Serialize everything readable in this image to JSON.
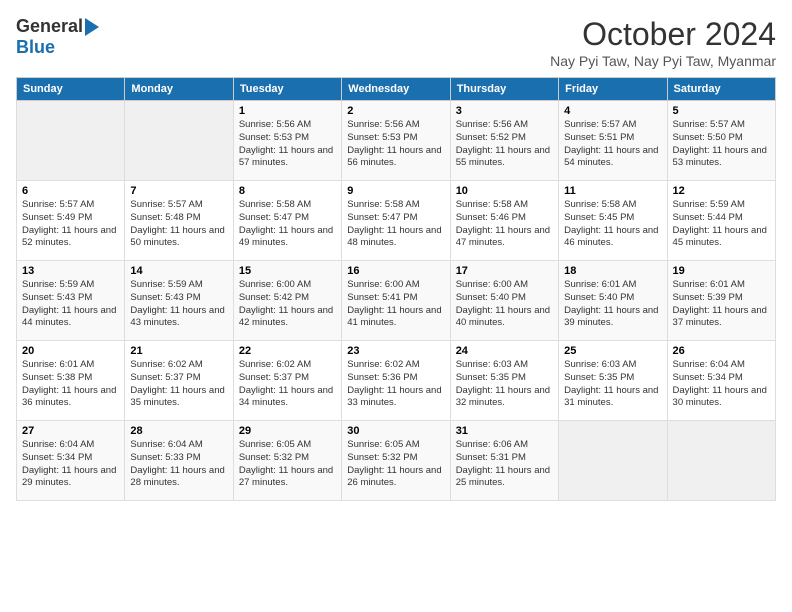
{
  "header": {
    "logo": {
      "general": "General",
      "blue": "Blue"
    },
    "title": "October 2024",
    "location": "Nay Pyi Taw, Nay Pyi Taw, Myanmar"
  },
  "days_of_week": [
    "Sunday",
    "Monday",
    "Tuesday",
    "Wednesday",
    "Thursday",
    "Friday",
    "Saturday"
  ],
  "weeks": [
    [
      {
        "num": "",
        "info": ""
      },
      {
        "num": "",
        "info": ""
      },
      {
        "num": "1",
        "info": "Sunrise: 5:56 AM\nSunset: 5:53 PM\nDaylight: 11 hours and 57 minutes."
      },
      {
        "num": "2",
        "info": "Sunrise: 5:56 AM\nSunset: 5:53 PM\nDaylight: 11 hours and 56 minutes."
      },
      {
        "num": "3",
        "info": "Sunrise: 5:56 AM\nSunset: 5:52 PM\nDaylight: 11 hours and 55 minutes."
      },
      {
        "num": "4",
        "info": "Sunrise: 5:57 AM\nSunset: 5:51 PM\nDaylight: 11 hours and 54 minutes."
      },
      {
        "num": "5",
        "info": "Sunrise: 5:57 AM\nSunset: 5:50 PM\nDaylight: 11 hours and 53 minutes."
      }
    ],
    [
      {
        "num": "6",
        "info": "Sunrise: 5:57 AM\nSunset: 5:49 PM\nDaylight: 11 hours and 52 minutes."
      },
      {
        "num": "7",
        "info": "Sunrise: 5:57 AM\nSunset: 5:48 PM\nDaylight: 11 hours and 50 minutes."
      },
      {
        "num": "8",
        "info": "Sunrise: 5:58 AM\nSunset: 5:47 PM\nDaylight: 11 hours and 49 minutes."
      },
      {
        "num": "9",
        "info": "Sunrise: 5:58 AM\nSunset: 5:47 PM\nDaylight: 11 hours and 48 minutes."
      },
      {
        "num": "10",
        "info": "Sunrise: 5:58 AM\nSunset: 5:46 PM\nDaylight: 11 hours and 47 minutes."
      },
      {
        "num": "11",
        "info": "Sunrise: 5:58 AM\nSunset: 5:45 PM\nDaylight: 11 hours and 46 minutes."
      },
      {
        "num": "12",
        "info": "Sunrise: 5:59 AM\nSunset: 5:44 PM\nDaylight: 11 hours and 45 minutes."
      }
    ],
    [
      {
        "num": "13",
        "info": "Sunrise: 5:59 AM\nSunset: 5:43 PM\nDaylight: 11 hours and 44 minutes."
      },
      {
        "num": "14",
        "info": "Sunrise: 5:59 AM\nSunset: 5:43 PM\nDaylight: 11 hours and 43 minutes."
      },
      {
        "num": "15",
        "info": "Sunrise: 6:00 AM\nSunset: 5:42 PM\nDaylight: 11 hours and 42 minutes."
      },
      {
        "num": "16",
        "info": "Sunrise: 6:00 AM\nSunset: 5:41 PM\nDaylight: 11 hours and 41 minutes."
      },
      {
        "num": "17",
        "info": "Sunrise: 6:00 AM\nSunset: 5:40 PM\nDaylight: 11 hours and 40 minutes."
      },
      {
        "num": "18",
        "info": "Sunrise: 6:01 AM\nSunset: 5:40 PM\nDaylight: 11 hours and 39 minutes."
      },
      {
        "num": "19",
        "info": "Sunrise: 6:01 AM\nSunset: 5:39 PM\nDaylight: 11 hours and 37 minutes."
      }
    ],
    [
      {
        "num": "20",
        "info": "Sunrise: 6:01 AM\nSunset: 5:38 PM\nDaylight: 11 hours and 36 minutes."
      },
      {
        "num": "21",
        "info": "Sunrise: 6:02 AM\nSunset: 5:37 PM\nDaylight: 11 hours and 35 minutes."
      },
      {
        "num": "22",
        "info": "Sunrise: 6:02 AM\nSunset: 5:37 PM\nDaylight: 11 hours and 34 minutes."
      },
      {
        "num": "23",
        "info": "Sunrise: 6:02 AM\nSunset: 5:36 PM\nDaylight: 11 hours and 33 minutes."
      },
      {
        "num": "24",
        "info": "Sunrise: 6:03 AM\nSunset: 5:35 PM\nDaylight: 11 hours and 32 minutes."
      },
      {
        "num": "25",
        "info": "Sunrise: 6:03 AM\nSunset: 5:35 PM\nDaylight: 11 hours and 31 minutes."
      },
      {
        "num": "26",
        "info": "Sunrise: 6:04 AM\nSunset: 5:34 PM\nDaylight: 11 hours and 30 minutes."
      }
    ],
    [
      {
        "num": "27",
        "info": "Sunrise: 6:04 AM\nSunset: 5:34 PM\nDaylight: 11 hours and 29 minutes."
      },
      {
        "num": "28",
        "info": "Sunrise: 6:04 AM\nSunset: 5:33 PM\nDaylight: 11 hours and 28 minutes."
      },
      {
        "num": "29",
        "info": "Sunrise: 6:05 AM\nSunset: 5:32 PM\nDaylight: 11 hours and 27 minutes."
      },
      {
        "num": "30",
        "info": "Sunrise: 6:05 AM\nSunset: 5:32 PM\nDaylight: 11 hours and 26 minutes."
      },
      {
        "num": "31",
        "info": "Sunrise: 6:06 AM\nSunset: 5:31 PM\nDaylight: 11 hours and 25 minutes."
      },
      {
        "num": "",
        "info": ""
      },
      {
        "num": "",
        "info": ""
      }
    ]
  ]
}
